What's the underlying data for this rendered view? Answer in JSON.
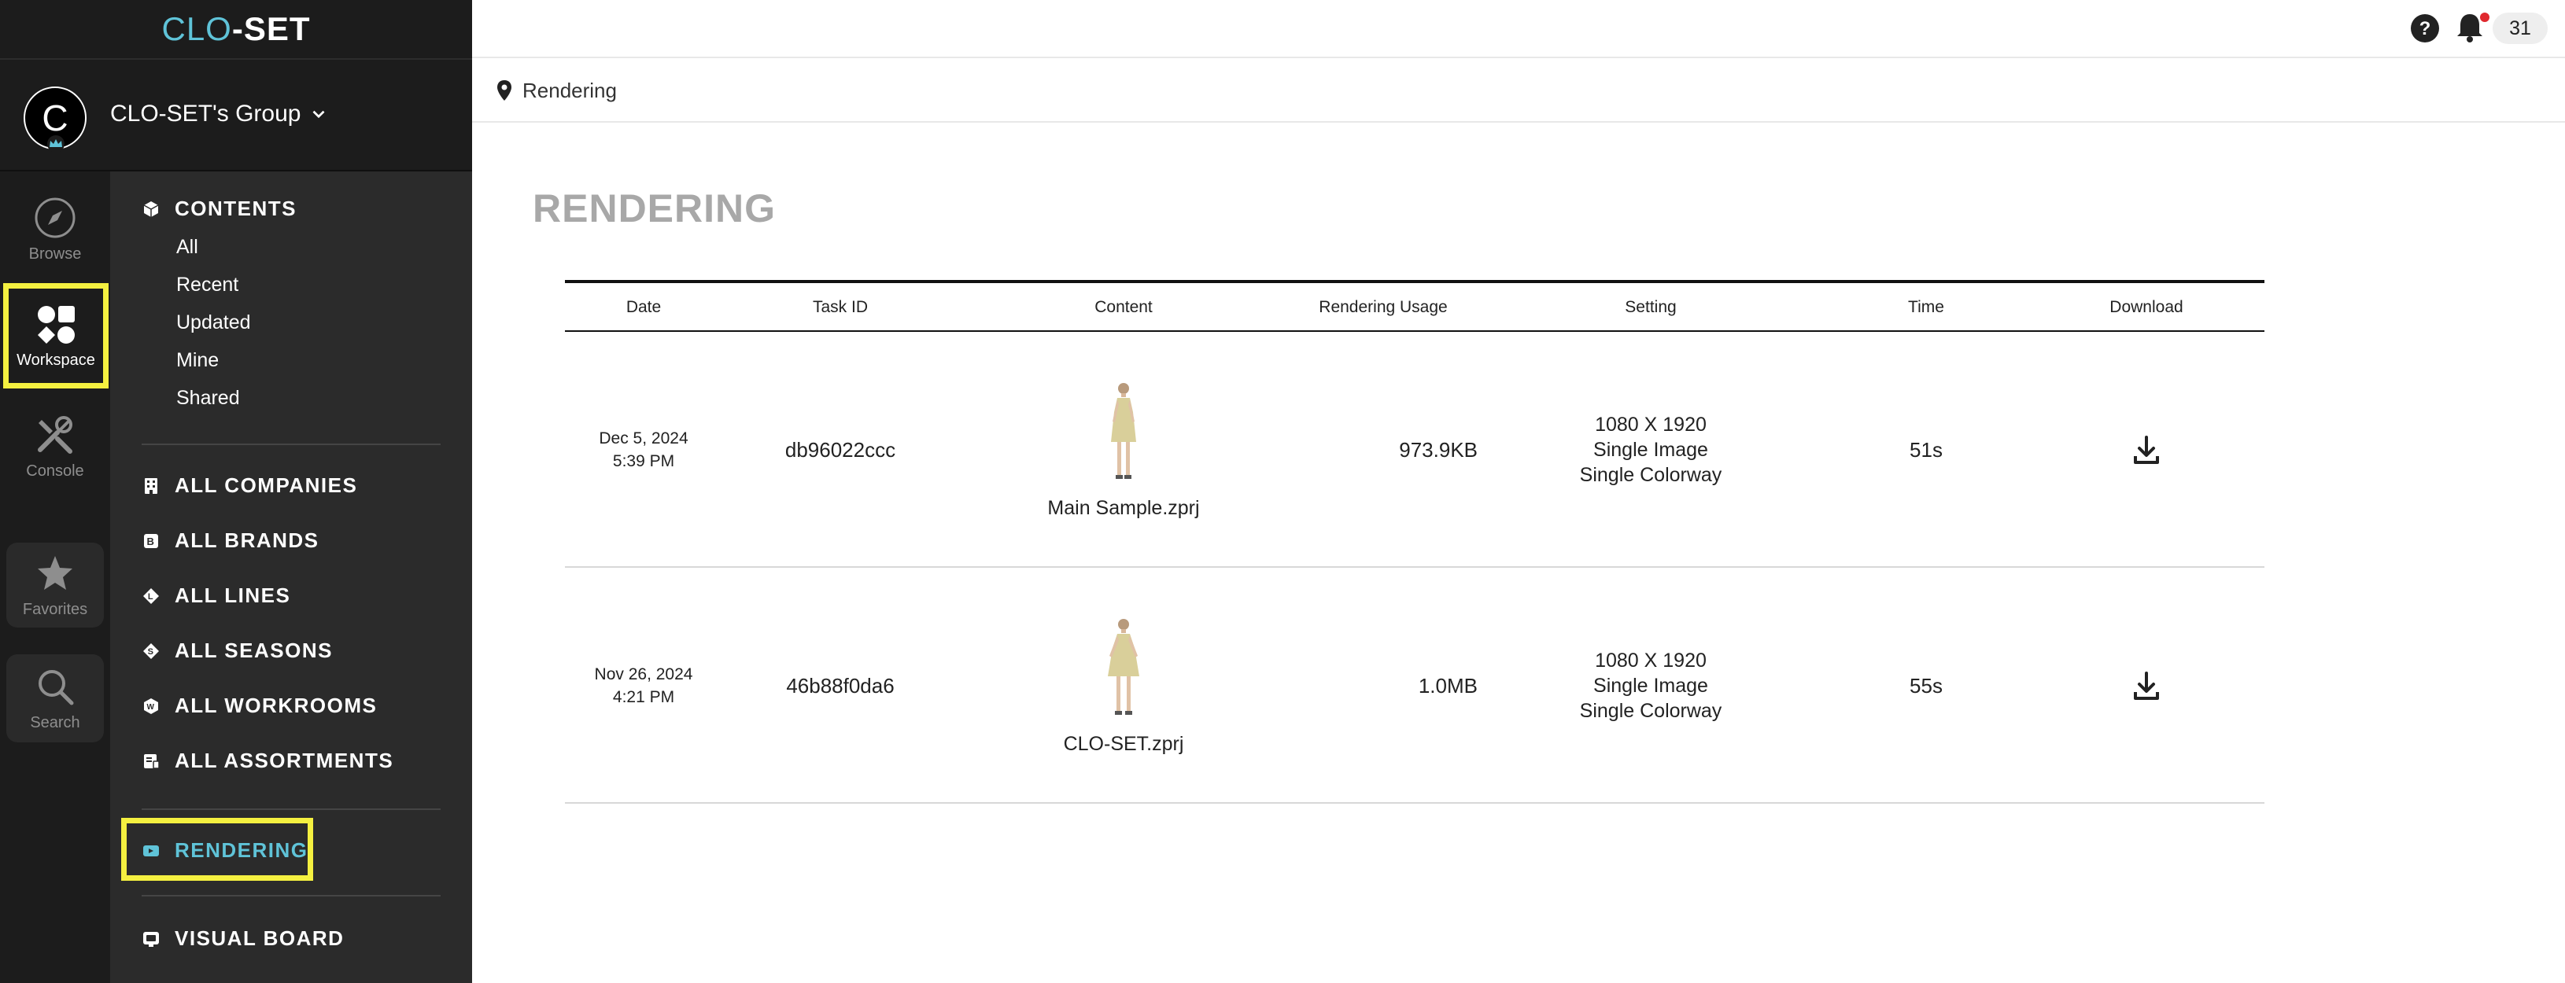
{
  "app": {
    "logo_text": "CLO-SET",
    "logo_accent": "CLO",
    "logo_rest": "-SET",
    "accent_color": "#5fc3d8",
    "highlight_color": "#f4f040"
  },
  "group": {
    "avatar_letter": "C",
    "name": "CLO-SET's Group"
  },
  "rail": [
    {
      "label": "Browse",
      "icon": "compass-icon"
    },
    {
      "label": "Workspace",
      "icon": "shapes-icon"
    },
    {
      "label": "Console",
      "icon": "tools-icon"
    },
    {
      "label": "Favorites",
      "icon": "star-icon"
    },
    {
      "label": "Search",
      "icon": "search-icon"
    }
  ],
  "menu": {
    "contents": "CONTENTS",
    "content_items": [
      "All",
      "Recent",
      "Updated",
      "Mine",
      "Shared"
    ],
    "sections": [
      "ALL COMPANIES",
      "ALL BRANDS",
      "ALL LINES",
      "ALL SEASONS",
      "ALL WORKROOMS",
      "ALL ASSORTMENTS"
    ],
    "rendering": "RENDERING",
    "visual_board": "VISUAL BOARD"
  },
  "topbar": {
    "notification_count": "31"
  },
  "breadcrumb": "Rendering",
  "page_title": "RENDERING",
  "table": {
    "headers": [
      "Date",
      "Task ID",
      "Content",
      "Rendering Usage",
      "Setting",
      "Time",
      "Download"
    ],
    "rows": [
      {
        "date": "Dec 5, 2024",
        "time_of_day": "5:39 PM",
        "task_id": "db96022ccc",
        "content": "Main Sample.zprj",
        "usage": "973.9KB",
        "setting": [
          "1080 X 1920",
          "Single Image",
          "Single Colorway"
        ],
        "time": "51s"
      },
      {
        "date": "Nov 26, 2024",
        "time_of_day": "4:21 PM",
        "task_id": "46b88f0da6",
        "content": "CLO-SET.zprj",
        "usage": "1.0MB",
        "setting": [
          "1080 X 1920",
          "Single Image",
          "Single Colorway"
        ],
        "time": "55s"
      }
    ]
  }
}
